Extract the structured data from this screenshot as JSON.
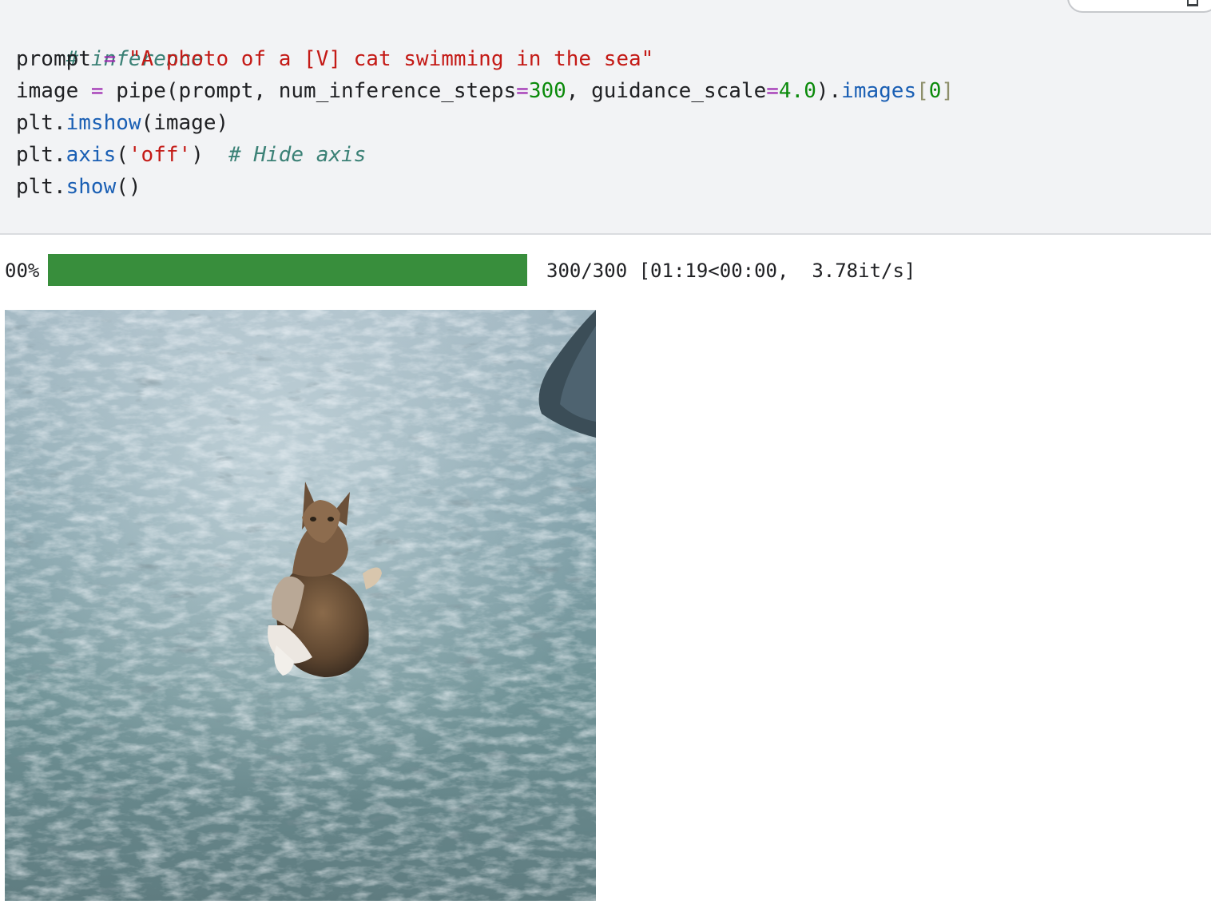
{
  "code": {
    "line1_comment": "# inference",
    "line2_var": "prompt",
    "line2_op": " = ",
    "line2_str": "\"A photo of a [V] cat swimming in the sea\"",
    "line3_var": "image",
    "line3_op": " = ",
    "line3_call": "pipe(prompt, num_inference_steps",
    "line3_eq1": "=",
    "line3_num1": "300",
    "line3_mid": ", guidance_scale",
    "line3_eq2": "=",
    "line3_num2": "4.0",
    "line3_close": ").",
    "line3_attr": "images",
    "line3_br_open": "[",
    "line3_idx": "0",
    "line3_br_close": "]",
    "line4_obj": "plt.",
    "line4_fn": "imshow",
    "line4_args": "(image)",
    "line5_obj": "plt.",
    "line5_fn": "axis",
    "line5_open": "(",
    "line5_str": "'off'",
    "line5_close": ")  ",
    "line5_comment": "# Hide axis",
    "line6_obj": "plt.",
    "line6_fn": "show",
    "line6_args": "()"
  },
  "progress": {
    "percent_label": "00%",
    "fraction": 1.0,
    "stats": "300/300 [01:19<00:00,  3.78it/s]"
  },
  "colors": {
    "progress_fill": "#388e3c",
    "cell_background": "#f2f3f5"
  },
  "icons": {
    "toolbar": "expand-icon"
  }
}
